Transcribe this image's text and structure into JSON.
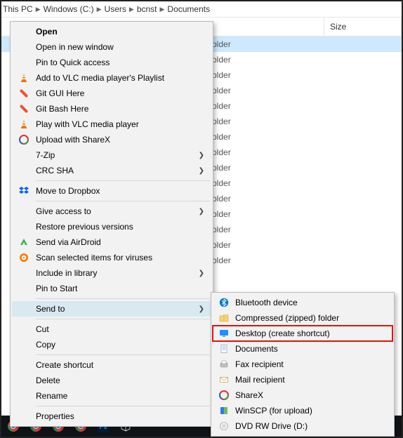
{
  "breadcrumb": {
    "p0": "This PC",
    "p1": "Windows (C:)",
    "p2": "Users",
    "p3": "bcnst",
    "p4": "Documents"
  },
  "headers": {
    "size": "Size"
  },
  "file_list": {
    "type": "older"
  },
  "context_menu": {
    "open": "Open",
    "open_new_window": "Open in new window",
    "pin_quick": "Pin to Quick access",
    "vlc_playlist": "Add to VLC media player's Playlist",
    "git_gui": "Git GUI Here",
    "git_bash": "Git Bash Here",
    "vlc_play": "Play with VLC media player",
    "sharex_upload": "Upload with ShareX",
    "seven_zip": "7-Zip",
    "crc_sha": "CRC SHA",
    "dropbox": "Move to Dropbox",
    "give_access": "Give access to",
    "restore_prev": "Restore previous versions",
    "airdroid": "Send via AirDroid",
    "avast_scan": "Scan selected items for viruses",
    "include_library": "Include in library",
    "pin_start": "Pin to Start",
    "send_to": "Send to",
    "cut": "Cut",
    "copy": "Copy",
    "create_shortcut": "Create shortcut",
    "delete": "Delete",
    "rename": "Rename",
    "properties": "Properties"
  },
  "submenu": {
    "bluetooth": "Bluetooth device",
    "compressed": "Compressed (zipped) folder",
    "desktop_shortcut": "Desktop (create shortcut)",
    "documents": "Documents",
    "fax": "Fax recipient",
    "mail": "Mail recipient",
    "sharex": "ShareX",
    "winscp": "WinSCP (for upload)",
    "dvd": "DVD RW Drive (D:)"
  }
}
